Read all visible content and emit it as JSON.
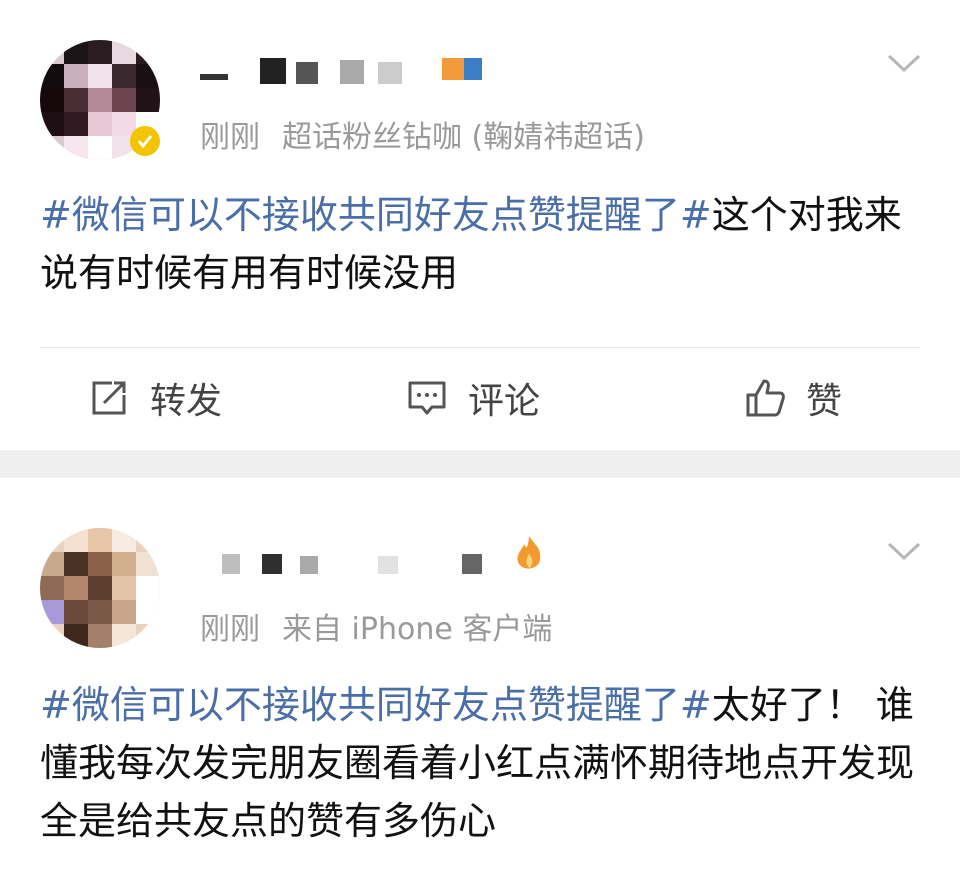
{
  "posts": [
    {
      "meta_time": "刚刚",
      "meta_source": "超话粉丝钻咖 (鞠婧祎超话)",
      "topic": "#微信可以不接收共同好友点赞提醒了#",
      "text": "这个对我来说有时候有用有时候没用",
      "actions": {
        "repost": "转发",
        "comment": "评论",
        "like": "赞"
      },
      "icons": {
        "menu": "chevron-down-icon",
        "repost": "repost-icon",
        "comment": "comment-icon",
        "like": "thumbs-up-icon",
        "badge": "vip-badge-icon"
      }
    },
    {
      "meta_time": "刚刚",
      "meta_source": "来自 iPhone 客户端",
      "topic": "#微信可以不接收共同好友点赞提醒了#",
      "text": "太好了！ 谁懂我每次发完朋友圈看着小红点满怀期待地点开发现全是给共友点的赞有多伤心",
      "icons": {
        "menu": "chevron-down-icon",
        "badge": "fire-badge-icon"
      }
    }
  ],
  "colors": {
    "topic_link": "#4a6ea8",
    "meta_gray": "#9a9a9a",
    "separator": "#efefef"
  }
}
